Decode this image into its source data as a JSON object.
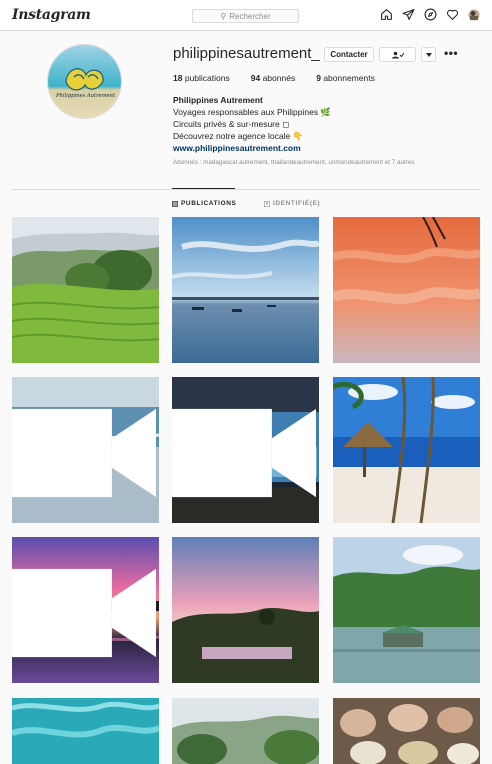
{
  "app": {
    "logo_text": "Instagram"
  },
  "search": {
    "placeholder": "Rechercher"
  },
  "nav_icons": [
    "home-icon",
    "direct-icon",
    "explore-icon",
    "activity-heart-icon",
    "profile-avatar-icon"
  ],
  "profile": {
    "username": "philippinesautrement_",
    "contact_label": "Contacter",
    "follow_icon": "person-check-icon",
    "dropdown_icon": "caret-down-icon",
    "more_icon": "more-dots-icon",
    "avatar_logo_text": "Philippines Autrement",
    "stats": {
      "publications_count": "18",
      "publications_label": "publications",
      "followers_count": "94",
      "followers_label": "abonnés",
      "following_count": "9",
      "following_label": "abonnements"
    },
    "bio": {
      "name": "Philippines Autrement",
      "line1": "Voyages responsables aux Philippines 🌿",
      "line2": "Circuits privés & sur-mesure ◻",
      "line3": "Découvrez notre agence locale 👇",
      "link": "www.philippinesautrement.com"
    },
    "followed_by": "Abonnés : madagascar.autrement, thailandeautrement, unmondeautrement et 7 autres"
  },
  "tabs": {
    "publications": "PUBLICATIONS",
    "tagged": "IDENTIFIÉ(E)"
  },
  "posts": [
    {
      "scene": "rice-terraces",
      "video": false
    },
    {
      "scene": "sea-boats-sunset",
      "video": false
    },
    {
      "scene": "orange-clouds",
      "video": false
    },
    {
      "scene": "beach-dogs",
      "video": true
    },
    {
      "scene": "night-market",
      "video": true
    },
    {
      "scene": "palm-beach-hut",
      "video": false
    },
    {
      "scene": "pink-sunset",
      "video": true
    },
    {
      "scene": "field-sunset",
      "video": false
    },
    {
      "scene": "lake-hut",
      "video": false
    },
    {
      "scene": "turquoise-water",
      "video": false
    },
    {
      "scene": "hills-trees",
      "video": false
    },
    {
      "scene": "market-baskets",
      "video": false
    }
  ]
}
